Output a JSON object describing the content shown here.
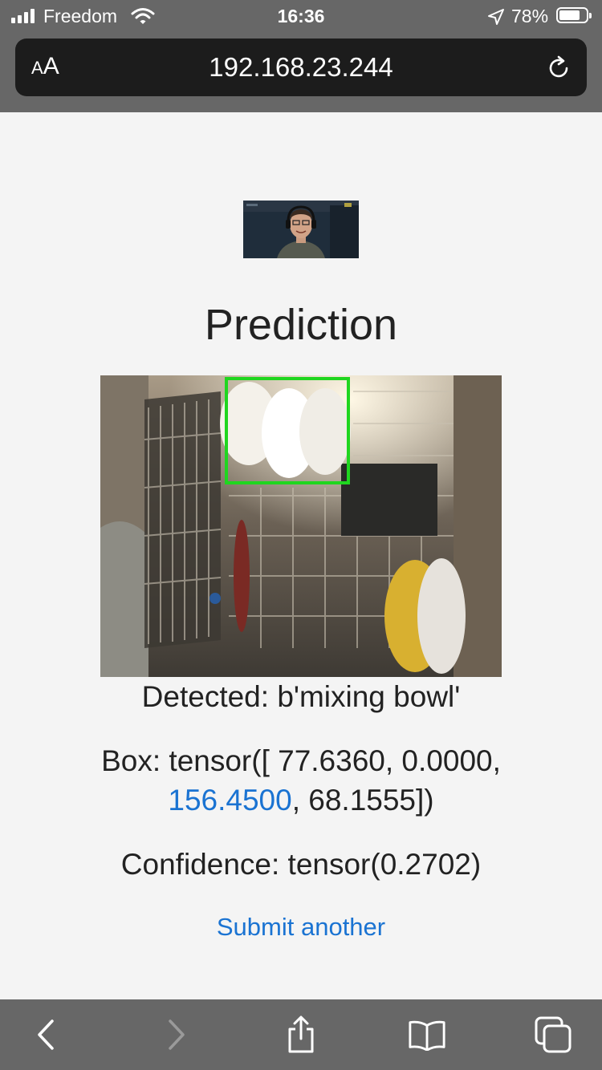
{
  "status_bar": {
    "carrier": "Freedom",
    "time": "16:36",
    "battery_percent": "78%",
    "battery_level": 0.78
  },
  "browser": {
    "text_size_label_small": "A",
    "text_size_label_large": "A",
    "url": "192.168.23.244"
  },
  "page": {
    "title": "Prediction",
    "detected_label": "Detected: b'mixing bowl'",
    "box_prefix": "Box: tensor([ 77.6360, 0.0000,",
    "box_link_value": "156.4500",
    "box_suffix": ", 68.1555])",
    "confidence_label": "Confidence: tensor(0.2702)",
    "submit_link": "Submit another"
  },
  "colors": {
    "chrome": "#676767",
    "url_bar": "#1c1c1c",
    "link": "#1a73d2",
    "bbox": "#1fd61f",
    "background": "#f4f4f4"
  },
  "icons": {
    "signal": "cellular-signal-icon",
    "wifi": "wifi-icon",
    "location": "location-arrow-icon",
    "battery": "battery-icon",
    "reload": "reload-icon",
    "back": "back-chevron-icon",
    "forward": "forward-chevron-icon",
    "share": "share-icon",
    "bookmarks": "bookmarks-icon",
    "tabs": "tabs-icon"
  }
}
